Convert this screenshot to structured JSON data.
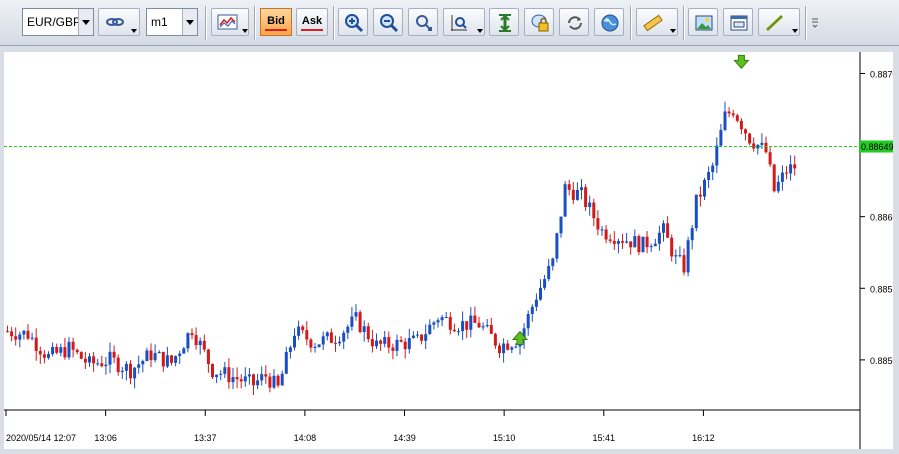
{
  "toolbar": {
    "symbol": "EUR/GBP",
    "timeframe": "m1",
    "bid_label": "Bid",
    "ask_label": "Ask"
  },
  "chart_data": {
    "type": "candlestick",
    "symbol": "EUR/GBP",
    "timeframe": "m1",
    "price_axis": {
      "ticks": [
        "0.8870",
        "0.8860",
        "0.8855",
        "0.8850"
      ],
      "tick_values": [
        0.887,
        0.886,
        0.8855,
        0.885
      ],
      "range": [
        0.88465,
        0.88715
      ]
    },
    "time_axis": {
      "labels": [
        "2020/05/14 12:07",
        "13:06",
        "13:37",
        "14:08",
        "14:39",
        "15:10",
        "15:41",
        "16:12"
      ]
    },
    "current_price": "0.88649",
    "current_price_value": 0.88649,
    "up_color": "#1a4fc4",
    "down_color": "#d21a1a",
    "price_line_color": "#22cc22",
    "markers": [
      {
        "type": "buy",
        "color": "#5cc020",
        "candle_index": 125,
        "value": 0.88517
      },
      {
        "type": "sell",
        "color": "#5cc020",
        "candle_index": 179,
        "value": 0.88705
      }
    ],
    "close_path": [
      [
        0,
        0.8852
      ],
      [
        5,
        0.88518
      ],
      [
        10,
        0.88502
      ],
      [
        15,
        0.88508
      ],
      [
        20,
        0.88497
      ],
      [
        25,
        0.885
      ],
      [
        30,
        0.88493
      ],
      [
        35,
        0.88504
      ],
      [
        40,
        0.88498
      ],
      [
        45,
        0.88522
      ],
      [
        50,
        0.88493
      ],
      [
        55,
        0.88488
      ],
      [
        60,
        0.88483
      ],
      [
        63,
        0.88489
      ],
      [
        66,
        0.8848
      ],
      [
        70,
        0.8852
      ],
      [
        75,
        0.88512
      ],
      [
        80,
        0.88516
      ],
      [
        85,
        0.88528
      ],
      [
        90,
        0.8851
      ],
      [
        95,
        0.88511
      ],
      [
        100,
        0.88513
      ],
      [
        105,
        0.8853
      ],
      [
        110,
        0.88525
      ],
      [
        115,
        0.88525
      ],
      [
        120,
        0.8851
      ],
      [
        125,
        0.88515
      ],
      [
        129,
        0.88545
      ],
      [
        133,
        0.88568
      ],
      [
        136,
        0.8862
      ],
      [
        140,
        0.88615
      ],
      [
        145,
        0.8859
      ],
      [
        150,
        0.88585
      ],
      [
        155,
        0.8858
      ],
      [
        160,
        0.8859
      ],
      [
        163,
        0.8857
      ],
      [
        165,
        0.88565
      ],
      [
        168,
        0.8861
      ],
      [
        172,
        0.88635
      ],
      [
        175,
        0.8867
      ],
      [
        177,
        0.88675
      ],
      [
        181,
        0.88655
      ],
      [
        185,
        0.88645
      ],
      [
        187,
        0.88618
      ],
      [
        190,
        0.88632
      ],
      [
        192,
        0.88635
      ]
    ],
    "candle_count": 193,
    "notes": "OHLC for each one-minute candle derived from close_path with small bodies and wicks"
  }
}
